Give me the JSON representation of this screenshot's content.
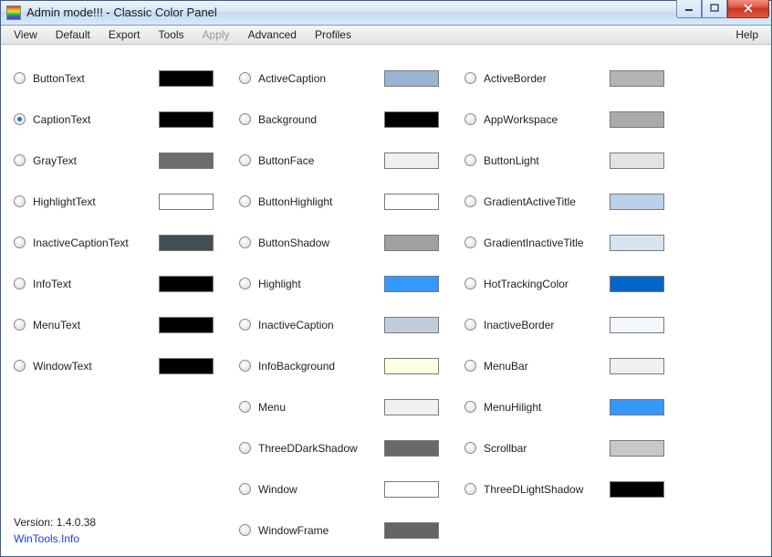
{
  "window": {
    "title": "Admin mode!!! - Classic Color Panel"
  },
  "menu": {
    "items": [
      "View",
      "Default",
      "Export",
      "Tools",
      "Apply",
      "Advanced",
      "Profiles"
    ],
    "disabled": [
      "Apply"
    ],
    "right": "Help"
  },
  "selected": "CaptionText",
  "columns": [
    [
      {
        "name": "ButtonText",
        "color": "#000000"
      },
      {
        "name": "CaptionText",
        "color": "#000000"
      },
      {
        "name": "GrayText",
        "color": "#6d6d6d"
      },
      {
        "name": "HighlightText",
        "color": "#ffffff"
      },
      {
        "name": "InactiveCaptionText",
        "color": "#434e54"
      },
      {
        "name": "InfoText",
        "color": "#000000"
      },
      {
        "name": "MenuText",
        "color": "#000000"
      },
      {
        "name": "WindowText",
        "color": "#000000"
      }
    ],
    [
      {
        "name": "ActiveCaption",
        "color": "#99b4d1"
      },
      {
        "name": "Background",
        "color": "#000000"
      },
      {
        "name": "ButtonFace",
        "color": "#f0f0f0"
      },
      {
        "name": "ButtonHighlight",
        "color": "#ffffff"
      },
      {
        "name": "ButtonShadow",
        "color": "#a0a0a0"
      },
      {
        "name": "Highlight",
        "color": "#3399ff"
      },
      {
        "name": "InactiveCaption",
        "color": "#bfcddb"
      },
      {
        "name": "InfoBackground",
        "color": "#ffffe1"
      },
      {
        "name": "Menu",
        "color": "#f0f0f0"
      },
      {
        "name": "ThreeDDarkShadow",
        "color": "#696969"
      },
      {
        "name": "Window",
        "color": "#ffffff"
      },
      {
        "name": "WindowFrame",
        "color": "#646464"
      }
    ],
    [
      {
        "name": "ActiveBorder",
        "color": "#b4b4b4"
      },
      {
        "name": "AppWorkspace",
        "color": "#ababab"
      },
      {
        "name": "ButtonLight",
        "color": "#e3e3e3"
      },
      {
        "name": "GradientActiveTitle",
        "color": "#b9d1ea"
      },
      {
        "name": "GradientInactiveTitle",
        "color": "#d7e4f2"
      },
      {
        "name": "HotTrackingColor",
        "color": "#0066cc"
      },
      {
        "name": "InactiveBorder",
        "color": "#f4f7fc"
      },
      {
        "name": "MenuBar",
        "color": "#f0f0f0"
      },
      {
        "name": "MenuHilight",
        "color": "#3399ff"
      },
      {
        "name": "Scrollbar",
        "color": "#c8c8c8"
      },
      {
        "name": "ThreeDLightShadow",
        "color": "#000000"
      }
    ]
  ],
  "footer": {
    "version": "Version: 1.4.0.38",
    "link": "WinTools.Info"
  }
}
